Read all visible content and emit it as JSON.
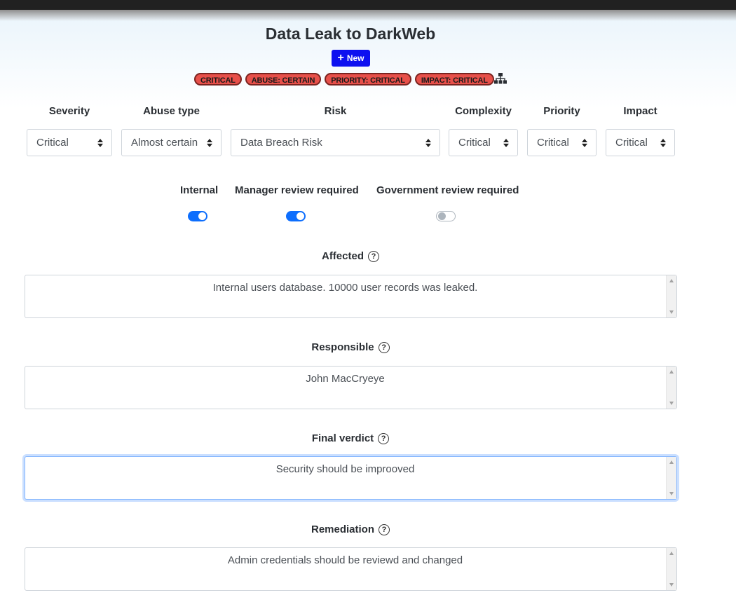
{
  "page": {
    "title": "Data Leak to DarkWeb",
    "new_button": "New"
  },
  "badges": [
    "CRITICAL",
    "ABUSE: CERTAIN",
    "PRIORITY: CRITICAL",
    "IMPACT: CRITICAL"
  ],
  "selects": {
    "severity": {
      "label": "Severity",
      "value": "Critical"
    },
    "abuse_type": {
      "label": "Abuse type",
      "value": "Almost certain"
    },
    "risk": {
      "label": "Risk",
      "value": "Data Breach Risk"
    },
    "complexity": {
      "label": "Complexity",
      "value": "Critical"
    },
    "priority": {
      "label": "Priority",
      "value": "Critical"
    },
    "impact": {
      "label": "Impact",
      "value": "Critical"
    }
  },
  "toggles": {
    "internal": {
      "label": "Internal",
      "on": true
    },
    "manager_review": {
      "label": "Manager review required",
      "on": true
    },
    "government_review": {
      "label": "Government review required",
      "on": false
    }
  },
  "fields": {
    "affected": {
      "label": "Affected",
      "value": "Internal users database. 10000 user records was leaked."
    },
    "responsible": {
      "label": "Responsible",
      "value": "John MacCryeye"
    },
    "final_verdict": {
      "label": "Final verdict",
      "value": "Security should be improoved"
    },
    "remediation": {
      "label": "Remediation",
      "value": "Admin credentials should be reviewd and changed"
    }
  },
  "icons": {
    "new": "plus-icon",
    "hierarchy": "sitemap-icon",
    "help": "question-circle-icon",
    "select_arrows": "sort-arrows-icon"
  },
  "colors": {
    "primary": "#0d6efd",
    "new_button": "#0d10f0",
    "badge": "#e7504a"
  }
}
